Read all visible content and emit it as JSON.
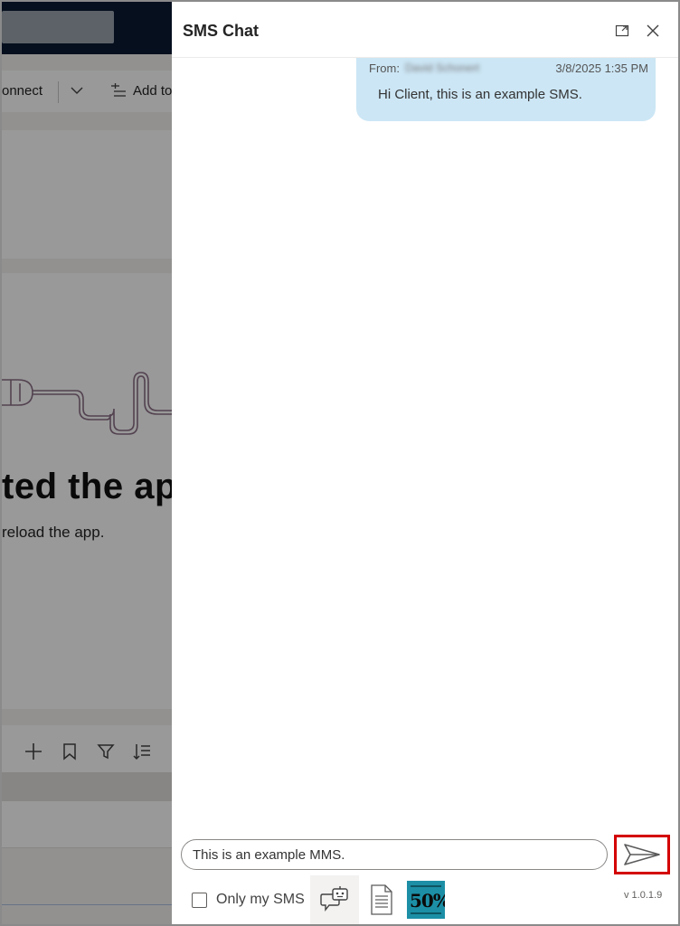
{
  "background_app": {
    "connect_text": "onnect",
    "add_to_text": "Add to",
    "error_title": "ted the ap",
    "error_subtitle": "reload the app."
  },
  "panel": {
    "title": "SMS Chat",
    "expand_icon": "expand-icon",
    "close_icon": "close-icon"
  },
  "messages": [
    {
      "from_label": "From:",
      "from_name": "David Schonert",
      "timestamp": "3/8/2025 1:35 PM",
      "text": "Hi Client, this is an example SMS."
    }
  ],
  "compose": {
    "value": "This is an example MMS.",
    "send_icon": "send-icon"
  },
  "footer": {
    "only_my_sms_label": "Only my SMS",
    "only_my_sms_checked": false,
    "tools": [
      "bot-chat-icon",
      "document-icon",
      "image-thumbnail"
    ],
    "image_thumbnail_text": "50%",
    "version": "v 1.0.1.9"
  },
  "colors": {
    "bubble": "#cce6f5",
    "send_highlight": "#d40000",
    "topbar": "#0b1a33"
  }
}
